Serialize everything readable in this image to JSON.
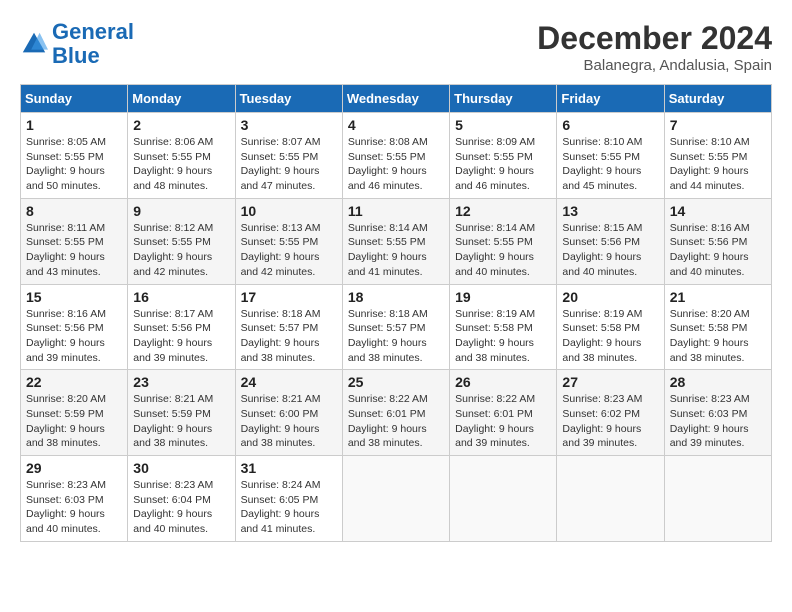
{
  "logo": {
    "line1": "General",
    "line2": "Blue"
  },
  "title": "December 2024",
  "location": "Balanegra, Andalusia, Spain",
  "weekdays": [
    "Sunday",
    "Monday",
    "Tuesday",
    "Wednesday",
    "Thursday",
    "Friday",
    "Saturday"
  ],
  "weeks": [
    [
      {
        "day": "1",
        "sunrise": "Sunrise: 8:05 AM",
        "sunset": "Sunset: 5:55 PM",
        "daylight": "Daylight: 9 hours and 50 minutes."
      },
      {
        "day": "2",
        "sunrise": "Sunrise: 8:06 AM",
        "sunset": "Sunset: 5:55 PM",
        "daylight": "Daylight: 9 hours and 48 minutes."
      },
      {
        "day": "3",
        "sunrise": "Sunrise: 8:07 AM",
        "sunset": "Sunset: 5:55 PM",
        "daylight": "Daylight: 9 hours and 47 minutes."
      },
      {
        "day": "4",
        "sunrise": "Sunrise: 8:08 AM",
        "sunset": "Sunset: 5:55 PM",
        "daylight": "Daylight: 9 hours and 46 minutes."
      },
      {
        "day": "5",
        "sunrise": "Sunrise: 8:09 AM",
        "sunset": "Sunset: 5:55 PM",
        "daylight": "Daylight: 9 hours and 46 minutes."
      },
      {
        "day": "6",
        "sunrise": "Sunrise: 8:10 AM",
        "sunset": "Sunset: 5:55 PM",
        "daylight": "Daylight: 9 hours and 45 minutes."
      },
      {
        "day": "7",
        "sunrise": "Sunrise: 8:10 AM",
        "sunset": "Sunset: 5:55 PM",
        "daylight": "Daylight: 9 hours and 44 minutes."
      }
    ],
    [
      {
        "day": "8",
        "sunrise": "Sunrise: 8:11 AM",
        "sunset": "Sunset: 5:55 PM",
        "daylight": "Daylight: 9 hours and 43 minutes."
      },
      {
        "day": "9",
        "sunrise": "Sunrise: 8:12 AM",
        "sunset": "Sunset: 5:55 PM",
        "daylight": "Daylight: 9 hours and 42 minutes."
      },
      {
        "day": "10",
        "sunrise": "Sunrise: 8:13 AM",
        "sunset": "Sunset: 5:55 PM",
        "daylight": "Daylight: 9 hours and 42 minutes."
      },
      {
        "day": "11",
        "sunrise": "Sunrise: 8:14 AM",
        "sunset": "Sunset: 5:55 PM",
        "daylight": "Daylight: 9 hours and 41 minutes."
      },
      {
        "day": "12",
        "sunrise": "Sunrise: 8:14 AM",
        "sunset": "Sunset: 5:55 PM",
        "daylight": "Daylight: 9 hours and 40 minutes."
      },
      {
        "day": "13",
        "sunrise": "Sunrise: 8:15 AM",
        "sunset": "Sunset: 5:56 PM",
        "daylight": "Daylight: 9 hours and 40 minutes."
      },
      {
        "day": "14",
        "sunrise": "Sunrise: 8:16 AM",
        "sunset": "Sunset: 5:56 PM",
        "daylight": "Daylight: 9 hours and 40 minutes."
      }
    ],
    [
      {
        "day": "15",
        "sunrise": "Sunrise: 8:16 AM",
        "sunset": "Sunset: 5:56 PM",
        "daylight": "Daylight: 9 hours and 39 minutes."
      },
      {
        "day": "16",
        "sunrise": "Sunrise: 8:17 AM",
        "sunset": "Sunset: 5:56 PM",
        "daylight": "Daylight: 9 hours and 39 minutes."
      },
      {
        "day": "17",
        "sunrise": "Sunrise: 8:18 AM",
        "sunset": "Sunset: 5:57 PM",
        "daylight": "Daylight: 9 hours and 38 minutes."
      },
      {
        "day": "18",
        "sunrise": "Sunrise: 8:18 AM",
        "sunset": "Sunset: 5:57 PM",
        "daylight": "Daylight: 9 hours and 38 minutes."
      },
      {
        "day": "19",
        "sunrise": "Sunrise: 8:19 AM",
        "sunset": "Sunset: 5:58 PM",
        "daylight": "Daylight: 9 hours and 38 minutes."
      },
      {
        "day": "20",
        "sunrise": "Sunrise: 8:19 AM",
        "sunset": "Sunset: 5:58 PM",
        "daylight": "Daylight: 9 hours and 38 minutes."
      },
      {
        "day": "21",
        "sunrise": "Sunrise: 8:20 AM",
        "sunset": "Sunset: 5:58 PM",
        "daylight": "Daylight: 9 hours and 38 minutes."
      }
    ],
    [
      {
        "day": "22",
        "sunrise": "Sunrise: 8:20 AM",
        "sunset": "Sunset: 5:59 PM",
        "daylight": "Daylight: 9 hours and 38 minutes."
      },
      {
        "day": "23",
        "sunrise": "Sunrise: 8:21 AM",
        "sunset": "Sunset: 5:59 PM",
        "daylight": "Daylight: 9 hours and 38 minutes."
      },
      {
        "day": "24",
        "sunrise": "Sunrise: 8:21 AM",
        "sunset": "Sunset: 6:00 PM",
        "daylight": "Daylight: 9 hours and 38 minutes."
      },
      {
        "day": "25",
        "sunrise": "Sunrise: 8:22 AM",
        "sunset": "Sunset: 6:01 PM",
        "daylight": "Daylight: 9 hours and 38 minutes."
      },
      {
        "day": "26",
        "sunrise": "Sunrise: 8:22 AM",
        "sunset": "Sunset: 6:01 PM",
        "daylight": "Daylight: 9 hours and 39 minutes."
      },
      {
        "day": "27",
        "sunrise": "Sunrise: 8:23 AM",
        "sunset": "Sunset: 6:02 PM",
        "daylight": "Daylight: 9 hours and 39 minutes."
      },
      {
        "day": "28",
        "sunrise": "Sunrise: 8:23 AM",
        "sunset": "Sunset: 6:03 PM",
        "daylight": "Daylight: 9 hours and 39 minutes."
      }
    ],
    [
      {
        "day": "29",
        "sunrise": "Sunrise: 8:23 AM",
        "sunset": "Sunset: 6:03 PM",
        "daylight": "Daylight: 9 hours and 40 minutes."
      },
      {
        "day": "30",
        "sunrise": "Sunrise: 8:23 AM",
        "sunset": "Sunset: 6:04 PM",
        "daylight": "Daylight: 9 hours and 40 minutes."
      },
      {
        "day": "31",
        "sunrise": "Sunrise: 8:24 AM",
        "sunset": "Sunset: 6:05 PM",
        "daylight": "Daylight: 9 hours and 41 minutes."
      },
      null,
      null,
      null,
      null
    ]
  ]
}
